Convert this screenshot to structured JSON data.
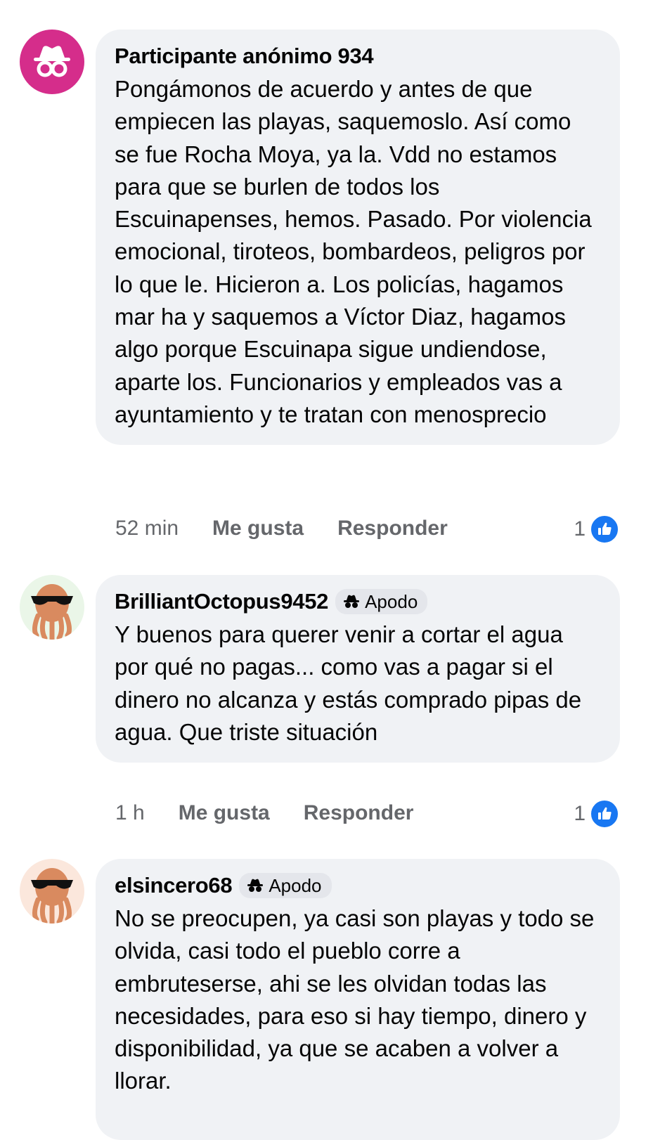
{
  "comments": [
    {
      "author": "Participante anónimo 934",
      "avatar_icon": "anonymous-incognito-icon",
      "badge": "",
      "text": "Pongámonos de acuerdo y antes de que empiecen las playas, saquemoslo. Así como se fue Rocha Moya, ya la. Vdd no estamos para que se burlen de todos los Escuinapenses, hemos. Pasado. Por violencia emocional, tiroteos, bombardeos, peligros por lo que le. Hicieron a. Los policías, hagamos mar ha y saquemos a Víctor Diaz, hagamos algo porque Escuinapa sigue undiendose, aparte los. Funcionarios y empleados vas a ayuntamiento y te tratan con menosprecio",
      "time": "52 min",
      "like_label": "Me gusta",
      "reply_label": "Responder",
      "reaction_count": "1"
    },
    {
      "author": "BrilliantOctopus9452",
      "avatar_icon": "octopus-sunglasses-avatar",
      "badge": "Apodo",
      "text": "Y buenos para querer venir a cortar el agua por qué no pagas... como vas a pagar si el dinero no alcanza y estás comprado pipas de agua. Que triste situación",
      "time": "1 h",
      "like_label": "Me gusta",
      "reply_label": "Responder",
      "reaction_count": "1"
    },
    {
      "author": "elsincero68",
      "avatar_icon": "octopus-sunglasses-avatar",
      "badge": "Apodo",
      "text": "No se preocupen, ya casi son playas y todo se olvida, casi todo el pueblo corre a embruteserse, ahi se les olvidan todas las necesidades, para eso si hay tiempo, dinero y disponibilidad, ya que se acaben a volver a llorar."
    }
  ],
  "colors": {
    "bubble": "#f0f2f5",
    "like_blue": "#1877f2",
    "anon_avatar": "#d52d8b",
    "meta_text": "#65676b"
  }
}
